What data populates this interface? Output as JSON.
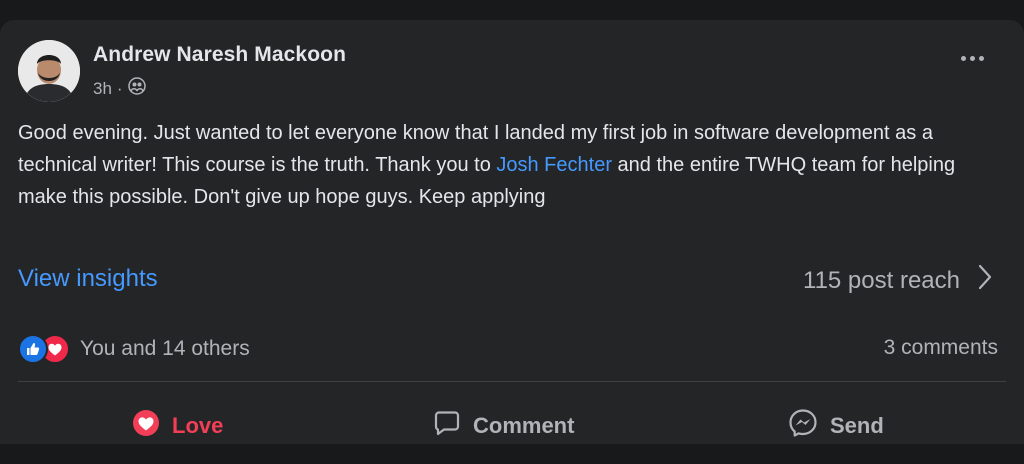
{
  "post": {
    "author": "Andrew Naresh Mackoon",
    "time": "3h",
    "audience_separator": "·",
    "audience_icon": "friends-icon",
    "body_before": "Good evening. Just wanted to let everyone know that I landed my first job in software development as a technical writer! This course is the truth. Thank you to ",
    "mention": "Josh Fechter",
    "body_after": " and the entire TWHQ team for helping make this possible. Don't give up hope guys. Keep applying"
  },
  "insights": {
    "label": "View insights",
    "reach": "115 post reach"
  },
  "reactions": {
    "text": "You and 14 others",
    "comments": "3 comments"
  },
  "actions": {
    "love": "Love",
    "comment": "Comment",
    "send": "Send"
  },
  "colors": {
    "background": "#18191a",
    "card": "#242526",
    "link": "#4599ff",
    "love": "#f33e58",
    "like": "#1b74e4",
    "secondary_text": "#b0b3b8"
  }
}
